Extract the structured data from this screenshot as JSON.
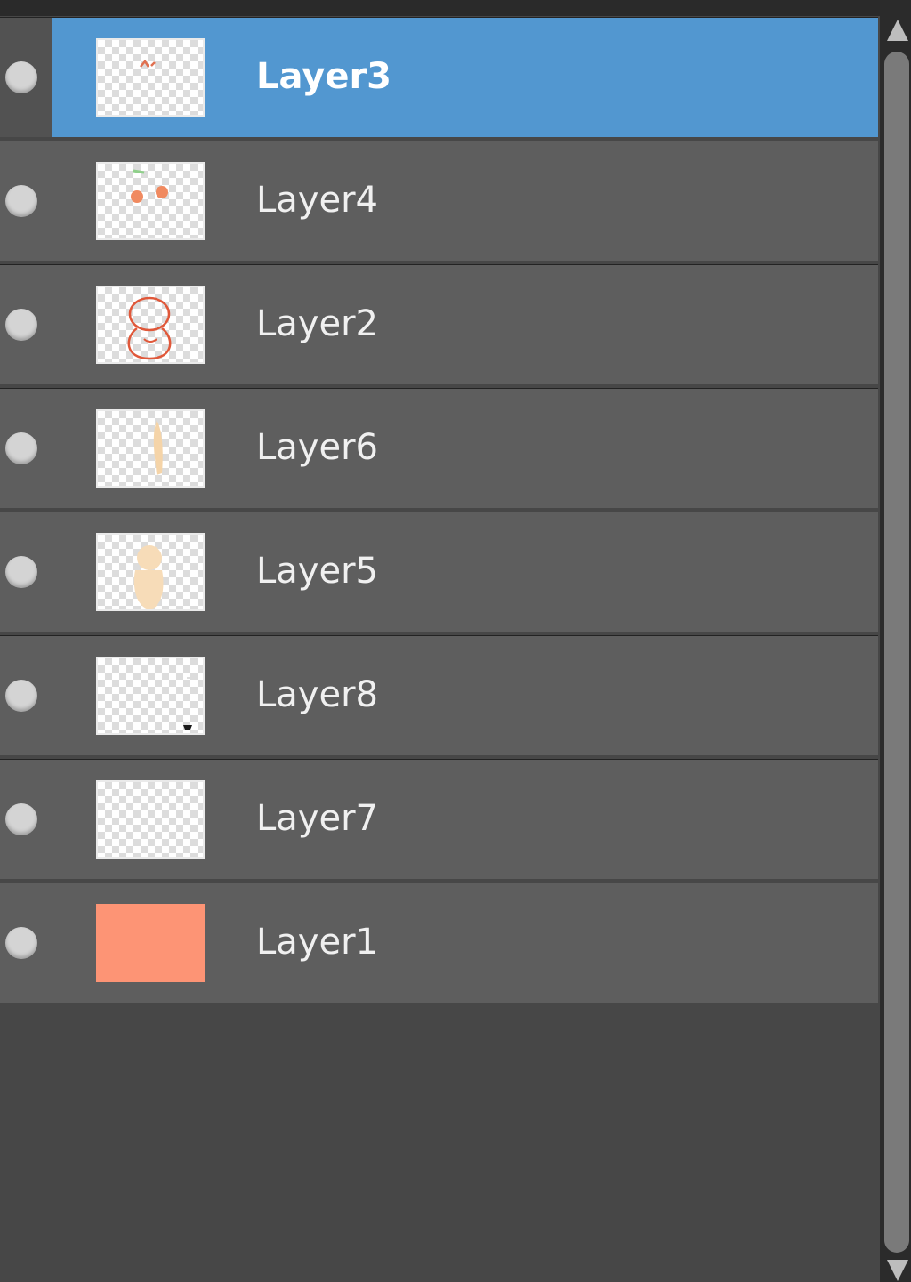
{
  "panel": {
    "selected_color": "#5297d0",
    "row_color": "#5e5e5e",
    "background_color": "#474747"
  },
  "layers": [
    {
      "label": "Layer3",
      "selected": true,
      "visible": true,
      "thumbnail": "small-orange-mark"
    },
    {
      "label": "Layer4",
      "selected": false,
      "visible": true,
      "thumbnail": "two-orange-dots"
    },
    {
      "label": "Layer2",
      "selected": false,
      "visible": true,
      "thumbnail": "red-outline-figure"
    },
    {
      "label": "Layer6",
      "selected": false,
      "visible": true,
      "thumbnail": "peach-vertical-stroke"
    },
    {
      "label": "Layer5",
      "selected": false,
      "visible": true,
      "thumbnail": "peach-body-shape"
    },
    {
      "label": "Layer8",
      "selected": false,
      "visible": true,
      "thumbnail": "dark-corner-mark"
    },
    {
      "label": "Layer7",
      "selected": false,
      "visible": true,
      "thumbnail": "empty-transparent"
    },
    {
      "label": "Layer1",
      "selected": false,
      "visible": true,
      "thumbnail": "solid-salmon-fill",
      "fill_color": "#fd9475"
    }
  ]
}
